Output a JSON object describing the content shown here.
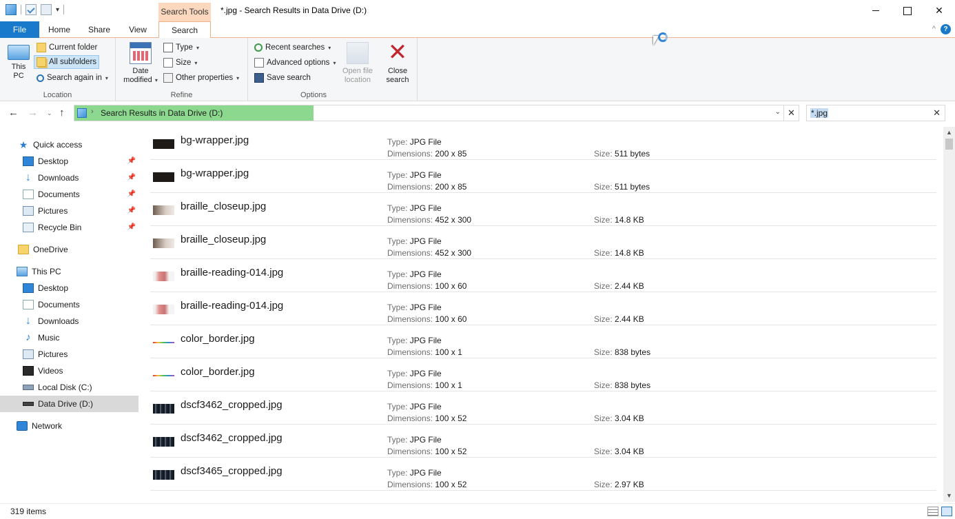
{
  "window": {
    "title": "*.jpg - Search Results in Data Drive (D:)",
    "context_tab": "Search Tools",
    "close_glyph": "✕"
  },
  "qat": {
    "dropdown": "▾"
  },
  "ribbon_tabs": [
    "File",
    "Home",
    "Share",
    "View",
    "Search"
  ],
  "ribbon": {
    "collapse_glyph": "^",
    "help_glyph": "?",
    "location": {
      "label": "Location",
      "this_pc": "This PC",
      "current_folder": "Current folder",
      "all_subfolders": "All subfolders",
      "search_again_in": "Search again in"
    },
    "refine": {
      "label": "Refine",
      "date_modified_line1": "Date",
      "date_modified_line2": "modified",
      "type": "Type",
      "size": "Size",
      "other_properties": "Other properties"
    },
    "options": {
      "label": "Options",
      "recent_searches": "Recent searches",
      "advanced_options": "Advanced options",
      "save_search": "Save search",
      "open_file_location_line1": "Open file",
      "open_file_location_line2": "location",
      "close_search_line1": "Close",
      "close_search_line2": "search"
    },
    "dropdown_glyph": "▾"
  },
  "nav": {
    "back": "←",
    "forward": "→",
    "recent": "⌄",
    "up": "↑",
    "address_separator": "›",
    "address": "Search Results in Data Drive (D:)",
    "address_dropdown": "⌄",
    "address_clear": "✕",
    "search_value": "*.jpg",
    "search_clear": "✕",
    "search_progress": 0.33
  },
  "sidebar": {
    "pin_glyph": "📌",
    "quick_access": "Quick access",
    "quick_items": [
      "Desktop",
      "Downloads",
      "Documents",
      "Pictures",
      "Recycle Bin"
    ],
    "onedrive": "OneDrive",
    "this_pc": "This PC",
    "pc_items": [
      "Desktop",
      "Documents",
      "Downloads",
      "Music",
      "Pictures",
      "Videos",
      "Local Disk (C:)",
      "Data Drive (D:)"
    ],
    "network": "Network",
    "selected": "Data Drive (D:)"
  },
  "labels": {
    "type": "Type:",
    "dimensions": "Dimensions:",
    "size": "Size:"
  },
  "files": [
    {
      "name": "bg-wrapper.jpg",
      "type": "JPG File",
      "dimensions": "200 x 85",
      "size": "511 bytes",
      "thumb": "dark"
    },
    {
      "name": "bg-wrapper.jpg",
      "type": "JPG File",
      "dimensions": "200 x 85",
      "size": "511 bytes",
      "thumb": "dark"
    },
    {
      "name": "braille_closeup.jpg",
      "type": "JPG File",
      "dimensions": "452 x 300",
      "size": "14.8 KB",
      "thumb": "braille"
    },
    {
      "name": "braille_closeup.jpg",
      "type": "JPG File",
      "dimensions": "452 x 300",
      "size": "14.8 KB",
      "thumb": "braille"
    },
    {
      "name": "braille-reading-014.jpg",
      "type": "JPG File",
      "dimensions": "100 x 60",
      "size": "2.44 KB",
      "thumb": "finger"
    },
    {
      "name": "braille-reading-014.jpg",
      "type": "JPG File",
      "dimensions": "100 x 60",
      "size": "2.44 KB",
      "thumb": "finger"
    },
    {
      "name": "color_border.jpg",
      "type": "JPG File",
      "dimensions": "100 x 1",
      "size": "838 bytes",
      "thumb": "color"
    },
    {
      "name": "color_border.jpg",
      "type": "JPG File",
      "dimensions": "100 x 1",
      "size": "838 bytes",
      "thumb": "color"
    },
    {
      "name": "dscf3462_cropped.jpg",
      "type": "JPG File",
      "dimensions": "100 x 52",
      "size": "3.04 KB",
      "thumb": "photo"
    },
    {
      "name": "dscf3462_cropped.jpg",
      "type": "JPG File",
      "dimensions": "100 x 52",
      "size": "3.04 KB",
      "thumb": "photo"
    },
    {
      "name": "dscf3465_cropped.jpg",
      "type": "JPG File",
      "dimensions": "100 x 52",
      "size": "2.97 KB",
      "thumb": "photo"
    }
  ],
  "scroll": {
    "up": "▲",
    "down": "▼"
  },
  "status": {
    "item_count": "319 items"
  }
}
